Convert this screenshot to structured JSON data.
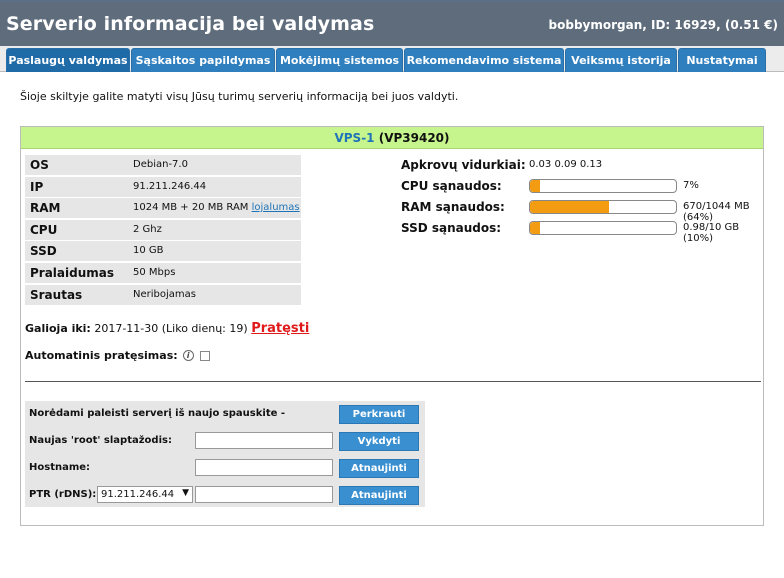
{
  "header": {
    "title": "Serverio informacija bei valdymas",
    "user": "bobbymorgan, ID: 16929, (0.51 €)"
  },
  "tabs": [
    {
      "label": "Paslaugų valdymas",
      "active": true
    },
    {
      "label": "Sąskaitos papildymas"
    },
    {
      "label": "Mokėjimų sistemos"
    },
    {
      "label": "Rekomendavimo sistema"
    },
    {
      "label": "Veiksmų istorija"
    },
    {
      "label": "Nustatymai"
    }
  ],
  "intro": "Šioje skiltyje galite matyti visų Jūsų turimų serverių informaciją bei juos valdyti.",
  "vps": {
    "name": "VPS-1",
    "code": "(VP39420)"
  },
  "specs": [
    {
      "key": "OS",
      "value": "Debian-7.0"
    },
    {
      "key": "IP",
      "value": "91.211.246.44"
    },
    {
      "key": "RAM",
      "value": "1024 MB + 20 MB RAM",
      "link": "lojalumas"
    },
    {
      "key": "CPU",
      "value": "2 Ghz"
    },
    {
      "key": "SSD",
      "value": "10 GB"
    },
    {
      "key": "Pralaidumas",
      "value": "50 Mbps"
    },
    {
      "key": "Srautas",
      "value": "Neribojamas"
    }
  ],
  "stats": {
    "load_label": "Apkrovų vidurkiai:",
    "load_value": "0.03 0.09 0.13",
    "cpu": {
      "label": "CPU sąnaudos:",
      "text": "7%",
      "fraction": 0.07
    },
    "ram": {
      "label": "RAM sąnaudos:",
      "text": "670/1044 MB (64%)",
      "fraction": 0.54
    },
    "ssd": {
      "label": "SSD sąnaudos:",
      "text": "0.98/10 GB (10%)",
      "fraction": 0.07
    }
  },
  "expiry": {
    "label": "Galioja iki:",
    "value": "2017-11-30 (Liko dienų: 19)",
    "renew": "Pratęsti"
  },
  "auto_renew": {
    "label": "Automatinis pratęsimas:",
    "info_icon": "i",
    "checked": false
  },
  "actions": {
    "restart_label": "Norėdami paleisti serverį iš naujo spauskite -",
    "restart_button": "Perkrauti",
    "root_label": "Naujas 'root' slaptažodis:",
    "root_value": "",
    "root_button": "Vykdyti",
    "hostname_label": "Hostname:",
    "hostname_value": "",
    "hostname_button": "Atnaujinti",
    "ptr_label": "PTR (rDNS):",
    "ptr_select": "91.211.246.44",
    "ptr_value": "",
    "ptr_button": "Atnaujinti"
  },
  "colors": {
    "header_bg": "#5e6c7c",
    "tab_bg": "#2f7fbf",
    "vps_head_bg": "#c6f58e",
    "bar_fill": "#f39c12",
    "renew": "#e01a1a"
  }
}
